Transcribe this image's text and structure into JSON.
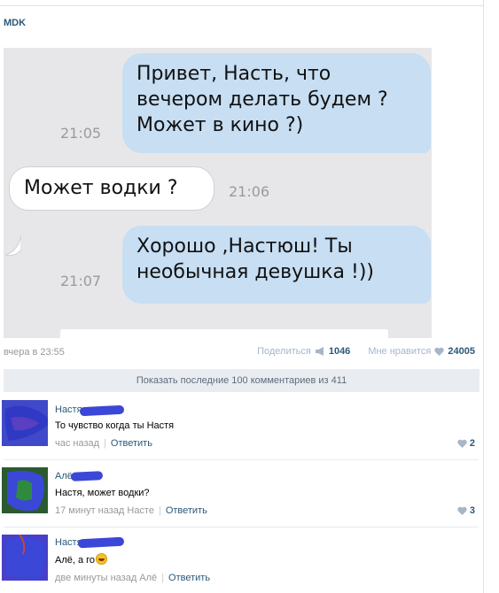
{
  "post": {
    "author": "MDK",
    "chat": [
      {
        "direction": "out",
        "lines": [
          "Привет, Насть, что",
          "вечером делать будем ?",
          "Может в кино ?)"
        ],
        "time": "21:05"
      },
      {
        "direction": "in",
        "lines": [
          "Может водки ?"
        ],
        "time": "21:06"
      },
      {
        "direction": "out",
        "lines": [
          "Хорошо ,Настюш! Ты",
          "необычная девушка !))"
        ],
        "time": "21:07"
      }
    ],
    "date": "вчера в 23:55",
    "share_label": "Поделиться",
    "share_count": "1046",
    "like_label": "Мне нравится",
    "like_count": "24005"
  },
  "comments_bar": {
    "show_more": "Показать последние 100 комментариев из 411"
  },
  "comments": [
    {
      "name": "Настя",
      "text": "То чувство когда ты Настя",
      "time": "час назад",
      "reply_label": "Ответить",
      "likes": "2",
      "avatar_color": "#3b47d6"
    },
    {
      "name": "Алё",
      "text": "Настя, может водки?",
      "time": "17 минут назад Насте",
      "reply_label": "Ответить",
      "likes": "3",
      "avatar_color": "#3b47d6"
    },
    {
      "name": "Настя",
      "text": "Алё, а го",
      "time": "две минуты назад Алё",
      "reply_label": "Ответить",
      "likes": "",
      "avatar_color": "#3b47d6"
    }
  ],
  "colors": {
    "link": "#2b587a",
    "bubble_out": "#c7def3",
    "bubble_in": "#ffffff",
    "scribble": "#3b47d6"
  }
}
